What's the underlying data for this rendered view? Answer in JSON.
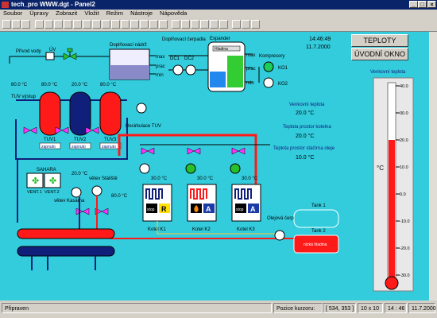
{
  "window": {
    "title": "tech_pro WWW.dgt - Panel2"
  },
  "menu": [
    "Soubor",
    "Úpravy",
    "Zobrazit",
    "Vložit",
    "Režim",
    "Nástroje",
    "Nápověda"
  ],
  "clock": {
    "time": "14:46:49",
    "date": "11.7.2000"
  },
  "buttons": {
    "teploty": "TEPLOTY",
    "uvod": "ÚVODNÍ OKNO"
  },
  "labels": {
    "privod_vody": "Přívod vody",
    "uv": "ÚV",
    "doplnovaci_nadrz": "Doplňovací nádrž",
    "doplnovaci_cerpadla": "Doplňovací čerpadla",
    "dc1": "DČ1",
    "dc2": "DČ2",
    "max": "max",
    "prac": "prac",
    "min": "min",
    "expander": "Expander",
    "hladina": "Hladina",
    "kompresory": "Kompresory",
    "ko1": "KO1",
    "ko2": "KO2",
    "tuv_vystup": "TUV výstup",
    "tuv1": "TUV1",
    "tuv2": "TUV2",
    "tuv3": "TUV3",
    "zapnuto": "zapnuto",
    "recirkulace": "Recirkulace TUV",
    "sahara": "SAHARA",
    "vent1": "VENT.1",
    "vent2": "VENT.2",
    "vetev_kasarna": "větev Kasárna",
    "vetev_stalisko": "větev Stáliště",
    "kotel1": "Kotel K1",
    "kotel2": "Kotel K2",
    "kotel3": "Kotel K3",
    "stop": "stop",
    "kotel1_mode": "R",
    "kotel2_mode": "A",
    "kotel3_mode": "A",
    "olejova_cerpadla": "Olejová čerpadla",
    "tank1": "Tank 1",
    "tank2": "Tank 2",
    "nizka_hladina": "nízká hladina",
    "venkovni_teplota": "Venkovní teplota",
    "teplota_kotelna": "Teplota prostor kotelna",
    "teplota_stacirna": "Teplota prostor stáčírna oleje",
    "thermo_title": "Venkovní teplota",
    "thermo_unit": "°C"
  },
  "temps": {
    "t1": "80.0 °C",
    "t2": "80.0 °C",
    "t3": "20.0 °C",
    "t4": "80.0 °C",
    "t5": "20.0 °C",
    "t6": "80.0 °C",
    "t7": "80.0 °C",
    "k1": "30.0 °C",
    "k2": "30.0 °C",
    "k3": "30.0 °C",
    "venkovni": "20.0 °C",
    "kotelna": "20.0 °C",
    "stacirna": "10.0 °C"
  },
  "thermometer": {
    "ticks": [
      "40.0",
      "30.0",
      "20.0",
      "10.0",
      "0.0",
      "-10.0",
      "-20.0",
      "-30.0"
    ],
    "level": 20.0,
    "min": -30,
    "max": 40
  },
  "status": {
    "ready": "Připraven",
    "pozice_label": "Pozice kurzoru:",
    "pozice_value": "[ 534, 353 ]",
    "grid": "10 x 10",
    "time": "14 : 46",
    "date": "11.7.2000"
  },
  "colors": {
    "canvas": "#33ccdd",
    "hot": "#ff1a1a",
    "cold": "#10207a",
    "accent": "#ff3030"
  }
}
